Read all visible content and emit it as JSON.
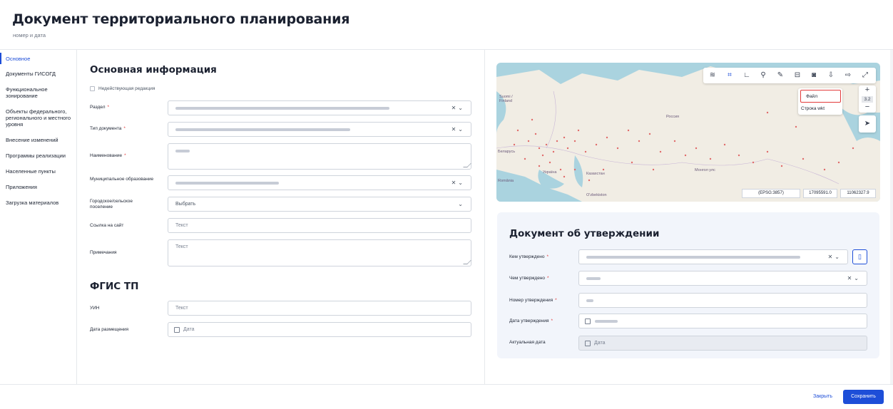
{
  "header": {
    "title": "Документ территориального планирования",
    "subtitle": "номер и дата"
  },
  "sidebar": {
    "items": [
      {
        "label": "Основное",
        "active": true
      },
      {
        "label": "Документы ГИСОГД"
      },
      {
        "label": "Функциональное зонирование"
      },
      {
        "label": "Объекты федерального, регионального и местного уровня"
      },
      {
        "label": "Внесение изменений"
      },
      {
        "label": "Программы реализации"
      },
      {
        "label": "Населенные пункты"
      },
      {
        "label": "Приложения"
      },
      {
        "label": "Загрузка материалов"
      }
    ]
  },
  "main_info": {
    "title": "Основная информация",
    "invalid_edition": "Недействующая редакция",
    "fields": {
      "section_label": "Раздел",
      "doc_type_label": "Тип документа",
      "name_label": "Наименование",
      "municipality_label": "Муниципальное образование",
      "settlement_label": "Городское/сельское поселение",
      "settlement_value": "Выбрать",
      "site_link_label": "Ссылка на сайт",
      "site_link_placeholder": "Текст",
      "notes_label": "Примечания",
      "notes_placeholder": "Текст"
    }
  },
  "fgis": {
    "title": "ФГИС ТП",
    "uin_label": "УИН",
    "uin_placeholder": "Текст",
    "date_label": "Дата размещения",
    "date_placeholder": "Дата"
  },
  "map": {
    "labels": {
      "finland": "Suomi / Finland",
      "russia": "Россия",
      "belarus": "Беларусь",
      "ukraine": "Україна",
      "romania": "România",
      "kazakhstan": "Казахстан",
      "uzbekistan": "O'zbekiston",
      "mongolia": "Монгол улс"
    },
    "zoom": "3.2",
    "dropdown": {
      "file": "Файл",
      "wkt": "Строка wkt"
    },
    "coords": {
      "crs": "(EPSG:3857)",
      "x": "17095591.0",
      "y": "11062327.9"
    }
  },
  "approval": {
    "title": "Документ об утверждении",
    "approved_by_label": "Кем утверждено",
    "approved_with_label": "Чем утверждено",
    "number_label": "Номер утверждения",
    "date_label": "Дата утверждения",
    "actual_date_label": "Актуальная дата",
    "actual_date_placeholder": "Дата"
  },
  "footer": {
    "close_label": "Закрыть",
    "save_label": "Сохранить"
  },
  "colors": {
    "accent": "#1d4ed8",
    "required": "#e23a3a"
  }
}
